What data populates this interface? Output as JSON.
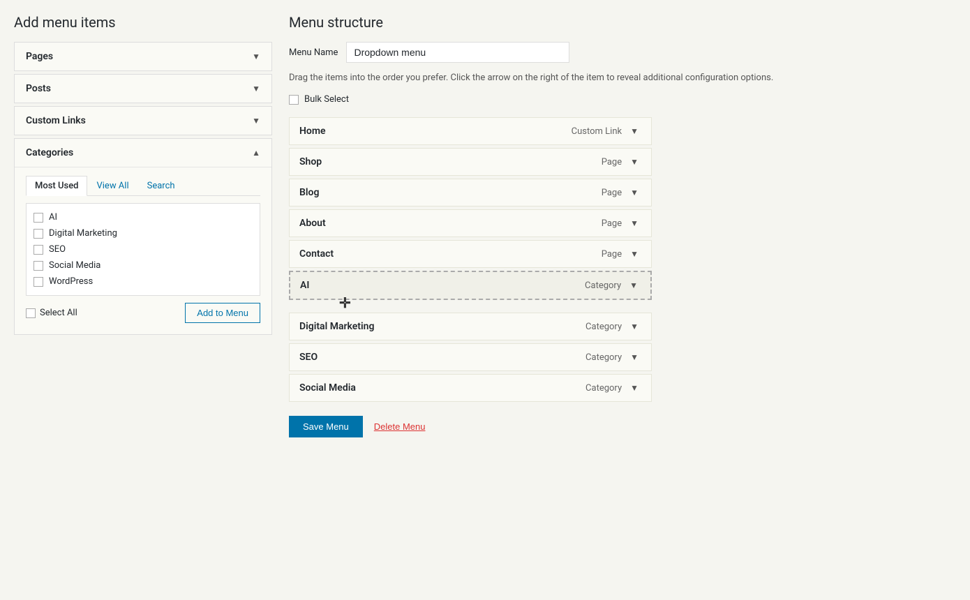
{
  "leftPanel": {
    "title": "Add menu items",
    "accordions": [
      {
        "id": "pages",
        "label": "Pages",
        "expanded": false,
        "arrow": "▼"
      },
      {
        "id": "posts",
        "label": "Posts",
        "expanded": false,
        "arrow": "▼"
      },
      {
        "id": "custom-links",
        "label": "Custom Links",
        "expanded": false,
        "arrow": "▼"
      },
      {
        "id": "categories",
        "label": "Categories",
        "expanded": true,
        "arrow": "▲"
      }
    ],
    "categories": {
      "tabs": [
        {
          "id": "most-used",
          "label": "Most Used",
          "active": true
        },
        {
          "id": "view-all",
          "label": "View All",
          "active": false
        },
        {
          "id": "search",
          "label": "Search",
          "active": false
        }
      ],
      "items": [
        {
          "id": "cat-ai",
          "label": "AI",
          "checked": false
        },
        {
          "id": "cat-digital",
          "label": "Digital Marketing",
          "checked": false
        },
        {
          "id": "cat-seo",
          "label": "SEO",
          "checked": false
        },
        {
          "id": "cat-social",
          "label": "Social Media",
          "checked": false
        },
        {
          "id": "cat-wp",
          "label": "WordPress",
          "checked": false
        }
      ],
      "selectAllLabel": "Select All",
      "addToMenuLabel": "Add to Menu"
    }
  },
  "rightPanel": {
    "title": "Menu structure",
    "menuNameLabel": "Menu Name",
    "menuNameValue": "Dropdown menu",
    "menuNamePlaceholder": "Dropdown menu",
    "dragHint": "Drag the items into the order you prefer. Click the arrow on the right of the item to reveal additional configuration options.",
    "bulkSelectLabel": "Bulk Select",
    "menuItems": [
      {
        "id": "home",
        "label": "Home",
        "type": "Custom Link",
        "dragging": false
      },
      {
        "id": "shop",
        "label": "Shop",
        "type": "Page",
        "dragging": false
      },
      {
        "id": "blog",
        "label": "Blog",
        "type": "Page",
        "dragging": false
      },
      {
        "id": "about",
        "label": "About",
        "type": "Page",
        "dragging": false
      },
      {
        "id": "contact",
        "label": "Contact",
        "type": "Page",
        "dragging": false
      },
      {
        "id": "ai",
        "label": "AI",
        "type": "Category",
        "dragging": true
      },
      {
        "id": "digital-marketing",
        "label": "Digital Marketing",
        "type": "Category",
        "dragging": false
      },
      {
        "id": "seo",
        "label": "SEO",
        "type": "Category",
        "dragging": false
      },
      {
        "id": "social-media",
        "label": "Social Media",
        "type": "Category",
        "dragging": false
      }
    ],
    "saveMenuLabel": "Save Menu",
    "deleteMenuLabel": "Delete Menu"
  }
}
